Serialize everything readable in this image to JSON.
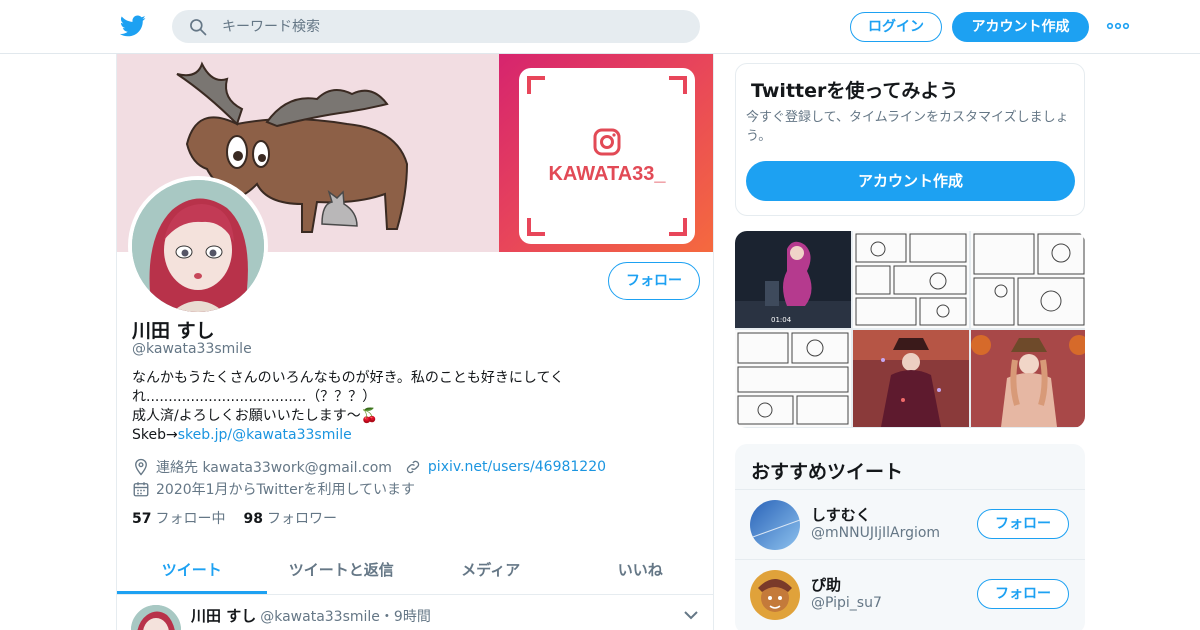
{
  "topbar": {
    "logo_icon": "twitter-bird-icon",
    "search_placeholder": "キーワード検索",
    "login_label": "ログイン",
    "signup_label": "アカウント作成",
    "more_icon": "more-dots-icon",
    "accent_color": "#1da1f2"
  },
  "profile": {
    "banner_tag": "KAWATA33_",
    "follow_label": "フォロー",
    "name": "川田 すし",
    "handle": "@kawata33smile",
    "bio": {
      "line1": "なんかもうたくさんのいろんなものが好き。私のことも好きにしてく",
      "line2": "れ....................................（？？？）",
      "line3": "成人済/よろしくお願いいたします～🍒",
      "line4_prefix": "Skeb→",
      "line4_link": "skeb.jp/@kawata33smile"
    },
    "location": "連絡先 kawata33work@gmail.com",
    "url": "pixiv.net/users/46981220",
    "joined": "2020年1月からTwitterを利用しています",
    "following_count": "57",
    "following_label": "フォロー中",
    "followers_count": "98",
    "followers_label": "フォロワー"
  },
  "tabs": [
    {
      "label": "ツイート"
    },
    {
      "label": "ツイートと返信"
    },
    {
      "label": "メディア"
    },
    {
      "label": "いいね"
    }
  ],
  "tweet": {
    "name": "川田 すし",
    "handle": "@kawata33smile",
    "time": "・9時間"
  },
  "signup_card": {
    "title": "Twitterを使ってみよう",
    "description": "今すぐ登録して、タイムラインをカスタマイズしましょう。",
    "button_label": "アカウント作成"
  },
  "media": {
    "video_time": "01:04"
  },
  "suggestions": {
    "title": "おすすめツイート",
    "items": [
      {
        "name": "しすむく",
        "handle": "@mNNUJIjIlArgiom",
        "button": "フォロー"
      },
      {
        "name": "ぴ助",
        "handle": "@Pipi_su7",
        "button": "フォロー"
      }
    ]
  }
}
